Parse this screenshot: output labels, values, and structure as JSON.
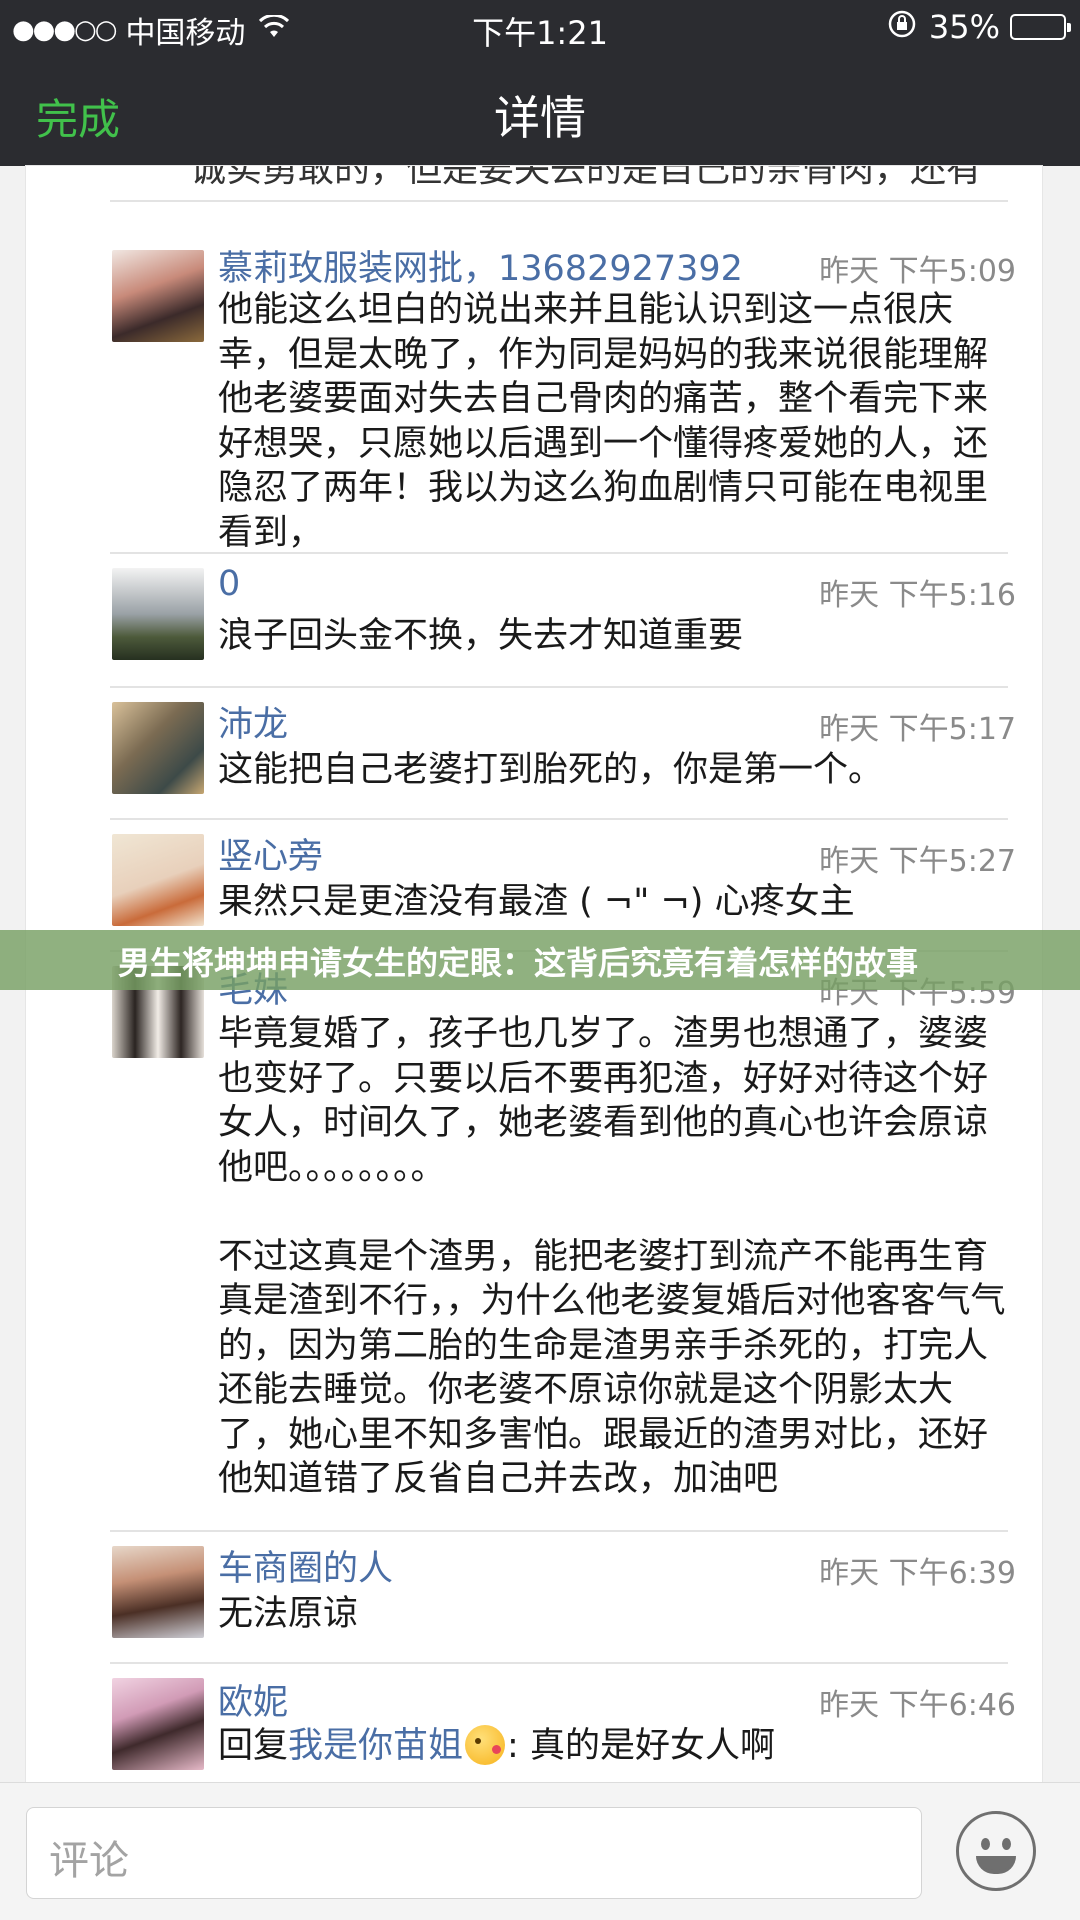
{
  "status_bar": {
    "signal": "●●●○○",
    "carrier": "中国移动",
    "time": "下午1:21",
    "battery_percent": "35%",
    "battery_level": 0.35
  },
  "nav": {
    "done_label": "完成",
    "title": "详情"
  },
  "clipped_line": "诚实勇敢的，但是要失去的是自己的亲骨肉，还有",
  "comments": [
    {
      "author": "慕莉玫服装网批，13682927392",
      "time": "昨天 下午5:09",
      "text": "他能这么坦白的说出来并且能认识到这一点很庆幸，但是太晚了，作为同是妈妈的我来说很能理解他老婆要面对失去自己骨肉的痛苦，整个看完下来好想哭，只愿她以后遇到一个懂得疼爱她的人，还隐忍了两年！我以为这么狗血剧情只可能在电视里看到，"
    },
    {
      "author": "0",
      "time": "昨天 下午5:16",
      "text": "浪子回头金不换，失去才知道重要"
    },
    {
      "author": "沛龙",
      "time": "昨天 下午5:17",
      "text": "这能把自己老婆打到胎死的，你是第一个。"
    },
    {
      "author": "竖心旁",
      "time": "昨天 下午5:27",
      "text": "果然只是更渣没有最渣 ( ¬\" ¬) 心疼女主"
    },
    {
      "author": "毛妹",
      "time": "昨天 下午5:59",
      "text": "毕竟复婚了，孩子也几岁了。渣男也想通了，婆婆也变好了。只要以后不要再犯渣，好好对待这个好女人，时间久了，她老婆看到他的真心也许会原谅他吧。。。。。。。。\n\n不过这真是个渣男，能把老婆打到流产不能再生育真是渣到不行，，为什么他老婆复婚后对他客客气气的，因为第二胎的生命是渣男亲手杀死的，打完人还能去睡觉。你老婆不原谅你就是这个阴影太大了，她心里不知多害怕。跟最近的渣男对比，还好他知道错了反省自己并去改，加油吧"
    },
    {
      "author": "车商圈的人",
      "time": "昨天 下午6:39",
      "text": "无法原谅"
    },
    {
      "author": "欧妮",
      "time": "昨天 下午6:46",
      "reply_prefix": "回复",
      "reply_to": "我是你苗姐",
      "text": ": 真的是好女人啊"
    }
  ],
  "headline": "男生将坤坤申请女生的定眼：这背后究竟有着怎样的故事",
  "input": {
    "placeholder": "评论"
  },
  "icons": {
    "wifi": "wifi-icon",
    "lock": "rotation-lock-icon",
    "battery": "battery-icon",
    "smiley": "emoji-smiley-icon"
  }
}
